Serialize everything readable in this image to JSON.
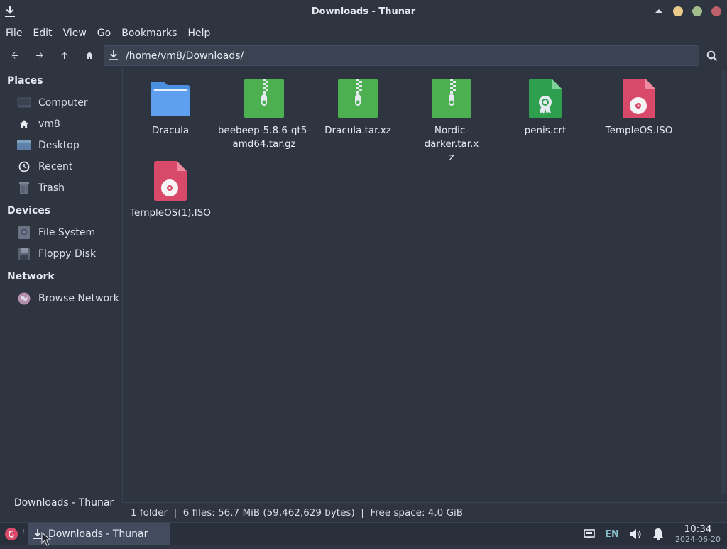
{
  "window": {
    "title": "Downloads - Thunar",
    "icon": "download-icon",
    "controls": [
      "shade-up-icon",
      "minimize-dot",
      "maximize-dot",
      "close-dot"
    ],
    "colors": {
      "minimize": "#ebcb8b",
      "maximize": "#a3be8c",
      "close": "#bf616a"
    }
  },
  "menubar": {
    "items": [
      "File",
      "Edit",
      "View",
      "Go",
      "Bookmarks",
      "Help"
    ]
  },
  "toolbar": {
    "back_icon": "arrow-left-icon",
    "forward_icon": "arrow-right-icon",
    "up_icon": "arrow-up-icon",
    "home_icon": "home-icon",
    "location": "/home/vm8/Downloads/",
    "search_icon": "search-icon"
  },
  "sidebar": {
    "places_title": "Places",
    "places": [
      {
        "label": "Computer",
        "icon": "computer-icon"
      },
      {
        "label": "vm8",
        "icon": "home-icon"
      },
      {
        "label": "Desktop",
        "icon": "desktop-folder-icon"
      },
      {
        "label": "Recent",
        "icon": "clock-icon"
      },
      {
        "label": "Trash",
        "icon": "trash-icon"
      }
    ],
    "devices_title": "Devices",
    "devices": [
      {
        "label": "File System",
        "icon": "harddisk-icon"
      },
      {
        "label": "Floppy Disk",
        "icon": "floppy-icon"
      }
    ],
    "network_title": "Network",
    "network": [
      {
        "label": "Browse Network",
        "icon": "network-globe-icon"
      }
    ]
  },
  "files": [
    {
      "name": "Dracula",
      "type": "folder"
    },
    {
      "name": "beebeep-5.8.6-qt5-amd64.tar.gz",
      "type": "archive"
    },
    {
      "name": "Dracula.tar.xz",
      "type": "archive"
    },
    {
      "name": "Nordic-darker.tar.xz",
      "type": "archive"
    },
    {
      "name": "penis.crt",
      "type": "certificate"
    },
    {
      "name": "TempleOS.ISO",
      "type": "disc-image"
    },
    {
      "name": "TempleOS(1).ISO",
      "type": "disc-image"
    }
  ],
  "status": {
    "text": "1 folder  |  6 files: 56.7 MiB (59,462,629 bytes)  |  Free space: 4.0 GiB"
  },
  "tooltip": {
    "text": "Downloads - Thunar"
  },
  "taskbar": {
    "task_label": "Downloads - Thunar",
    "lang": "EN",
    "time": "10:34",
    "date": "2024-06-20"
  }
}
